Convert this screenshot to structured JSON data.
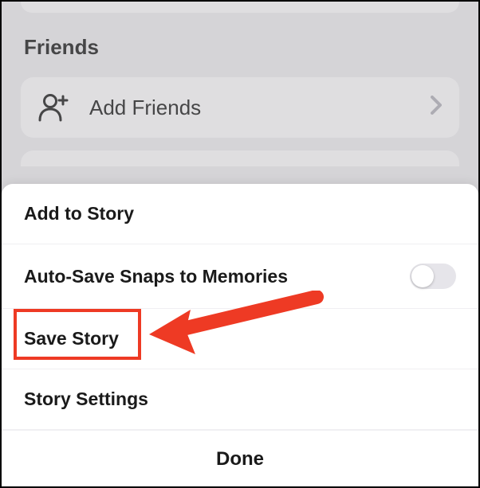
{
  "background": {
    "section_title": "Friends",
    "add_friends_label": "Add Friends"
  },
  "sheet": {
    "items": [
      {
        "label": "Add to Story",
        "has_toggle": false
      },
      {
        "label": "Auto-Save Snaps to Memories",
        "has_toggle": true,
        "toggle_on": false
      },
      {
        "label": "Save Story",
        "has_toggle": false
      },
      {
        "label": "Story Settings",
        "has_toggle": false
      }
    ],
    "done_label": "Done"
  },
  "annotation": {
    "highlighted_item": "Save Story",
    "highlight_color": "#ee3a24"
  }
}
